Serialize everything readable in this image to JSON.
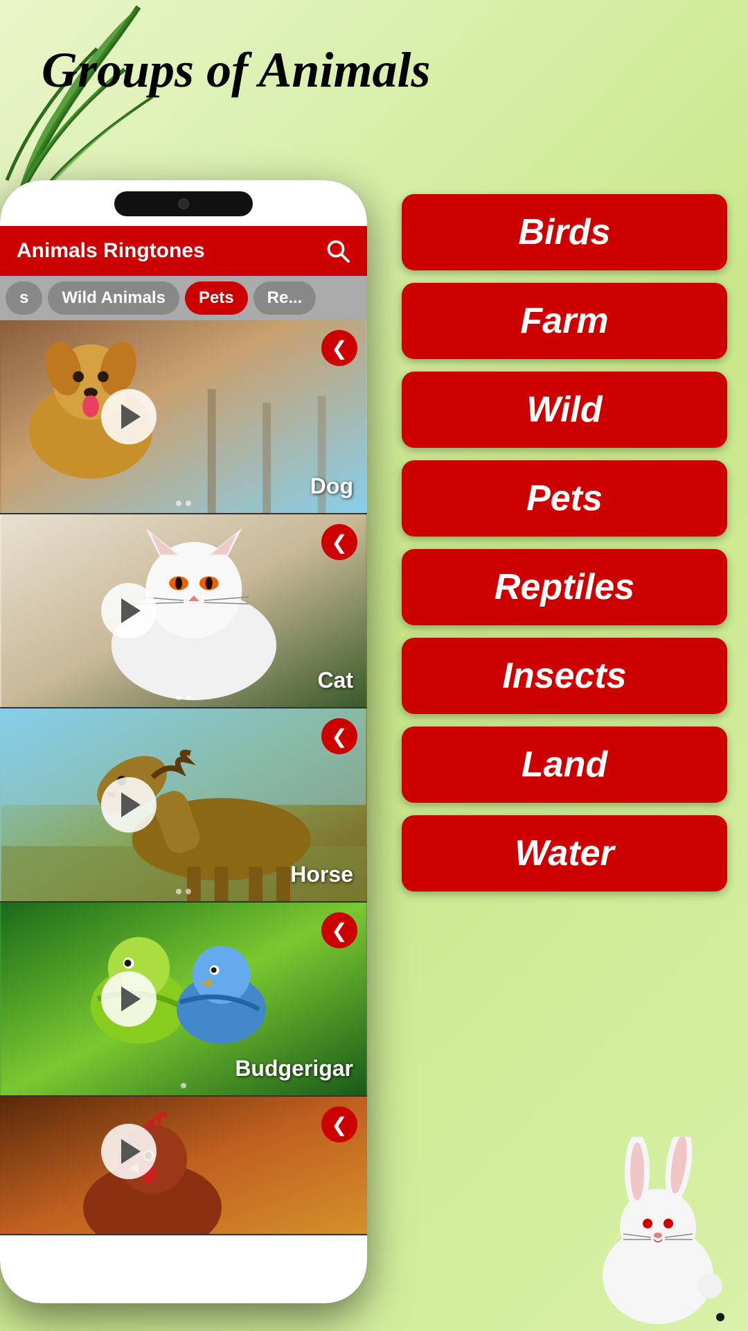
{
  "page": {
    "title": "Groups of Animals",
    "background_color": "#d4e8a0"
  },
  "app": {
    "header_title": "Animals Ringtones",
    "search_icon": "🔍"
  },
  "tabs": [
    {
      "label": "s",
      "active": false
    },
    {
      "label": "Wild Animals",
      "active": false
    },
    {
      "label": "Pets",
      "active": true
    },
    {
      "label": "Re...",
      "active": false
    }
  ],
  "animal_cards": [
    {
      "name": "Dog",
      "type": "dog",
      "emoji": "🐕"
    },
    {
      "name": "Cat",
      "type": "cat",
      "emoji": "🐈"
    },
    {
      "name": "Horse",
      "type": "horse",
      "emoji": "🐎"
    },
    {
      "name": "Budgerigar",
      "type": "bird",
      "emoji": "🦜"
    },
    {
      "name": "Chicken",
      "type": "chicken",
      "emoji": "🐓"
    }
  ],
  "category_buttons": [
    {
      "label": "Birds"
    },
    {
      "label": "Farm"
    },
    {
      "label": "Wild"
    },
    {
      "label": "Pets"
    },
    {
      "label": "Reptiles"
    },
    {
      "label": "Insects"
    },
    {
      "label": "Land"
    },
    {
      "label": "Water"
    }
  ]
}
